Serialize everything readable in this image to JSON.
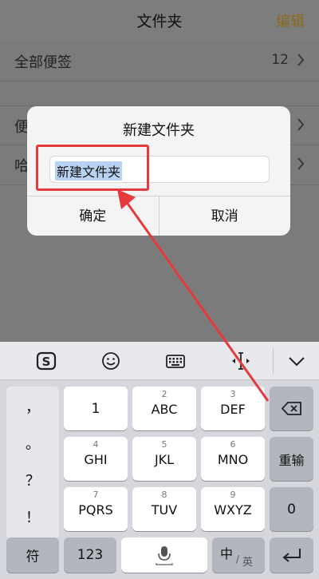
{
  "header": {
    "title": "文件夹",
    "edit_label": "编辑"
  },
  "folders": [
    {
      "label": "全部便签",
      "count": "12"
    },
    {
      "label": "便",
      "count": ""
    },
    {
      "label": "哈",
      "count": ""
    }
  ],
  "dialog": {
    "title": "新建文件夹",
    "input_value": "新建文件夹",
    "confirm_label": "确定",
    "cancel_label": "取消"
  },
  "keyboard": {
    "toolbar_icons": [
      "sogou-logo-icon",
      "emoji-icon",
      "keyboard-icon",
      "cursor-move-icon",
      "collapse-chevron-icon"
    ],
    "punctuation": [
      "，",
      "。",
      "？",
      "！"
    ],
    "rows": [
      [
        {
          "num": "",
          "main": "1"
        },
        {
          "num": "2",
          "main": "ABC"
        },
        {
          "num": "3",
          "main": "DEF"
        }
      ],
      [
        {
          "num": "4",
          "main": "GHI"
        },
        {
          "num": "5",
          "main": "JKL"
        },
        {
          "num": "6",
          "main": "MNO"
        }
      ],
      [
        {
          "num": "7",
          "main": "PQRS"
        },
        {
          "num": "8",
          "main": "TUV"
        },
        {
          "num": "9",
          "main": "WXYZ"
        }
      ]
    ],
    "right_keys": {
      "retype": "重输",
      "zero": "0"
    },
    "bottom": {
      "symbols": "符",
      "numbers": "123",
      "lang_zh": "中",
      "lang_en": "英"
    }
  },
  "colors": {
    "annotation_red": "#e5393d",
    "selection_blue": "#b8d3f1"
  }
}
